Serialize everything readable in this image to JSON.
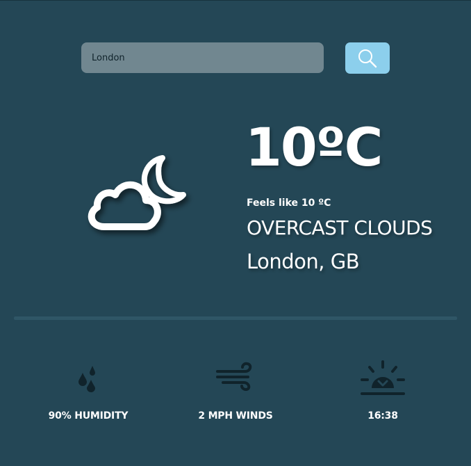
{
  "search": {
    "value": "London",
    "button_icon": "search-icon"
  },
  "current": {
    "icon": "cloud-moon-icon",
    "temperature": "10ºC",
    "feels_like": "Feels like 10 ºC",
    "description": "OVERCAST CLOUDS",
    "location": "London, GB"
  },
  "stats": {
    "humidity": {
      "icon": "humidity-drops-icon",
      "label": "90% HUMIDITY"
    },
    "wind": {
      "icon": "wind-icon",
      "label": "2 MPH WINDS"
    },
    "sunset": {
      "icon": "sunset-icon",
      "label": "16:38"
    }
  },
  "colors": {
    "background": "#244756",
    "search_field": "#718790",
    "search_button": "#8ccfec",
    "icon_dark": "#10232b",
    "text": "#ffffff"
  }
}
